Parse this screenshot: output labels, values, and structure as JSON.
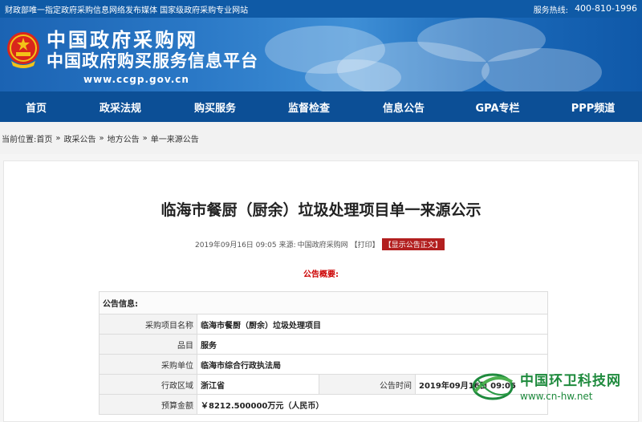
{
  "topbar": {
    "left_text": "财政部唯一指定政府采购信息网络发布媒体 国家级政府采购专业网站",
    "hotline_label": "服务热线:",
    "hotline_number": "400-810-1996"
  },
  "banner": {
    "title_cn": "中国政府采购网",
    "subtitle_cn": "中国政府购买服务信息平台",
    "url": "www.ccgp.gov.cn"
  },
  "nav": {
    "items": [
      {
        "label": "首页"
      },
      {
        "label": "政采法规"
      },
      {
        "label": "购买服务"
      },
      {
        "label": "监督检查"
      },
      {
        "label": "信息公告"
      },
      {
        "label": "GPA专栏"
      },
      {
        "label": "PPP频道"
      }
    ]
  },
  "breadcrumb": {
    "prefix": "当前位置:",
    "items": [
      "首页",
      "政采公告",
      "地方公告",
      "单一来源公告"
    ],
    "separator": "»"
  },
  "article": {
    "title": "临海市餐厨（厨余）垃圾处理项目单一来源公示",
    "date": "2019年09月16日 09:05",
    "source_label": "来源:",
    "source": "中国政府采购网",
    "print_label": "【打印】",
    "show_text_label": "【显示公告正文】",
    "summary_heading": "公告概要:"
  },
  "info_table": {
    "header": "公告信息:",
    "rows": [
      {
        "label": "采购项目名称",
        "value": "临海市餐厨（厨余）垃圾处理项目"
      },
      {
        "label": "品目",
        "value": "服务"
      },
      {
        "label": "采购单位",
        "value": "临海市综合行政执法局"
      },
      {
        "label": "行政区域",
        "value": "浙江省",
        "label2": "公告时间",
        "value2": "2019年09月16日 09:05"
      },
      {
        "label": "预算金额",
        "value": "￥8212.500000万元（人民币）"
      }
    ]
  },
  "watermark": {
    "name": "中国环卫科技网",
    "url": "www.cn-hw.net"
  },
  "colors": {
    "nav_bg": "#0c4f96",
    "banner_bg": "#2a78c6",
    "accent_red": "#b21f1f",
    "watermark_green": "#1e8a3d"
  }
}
